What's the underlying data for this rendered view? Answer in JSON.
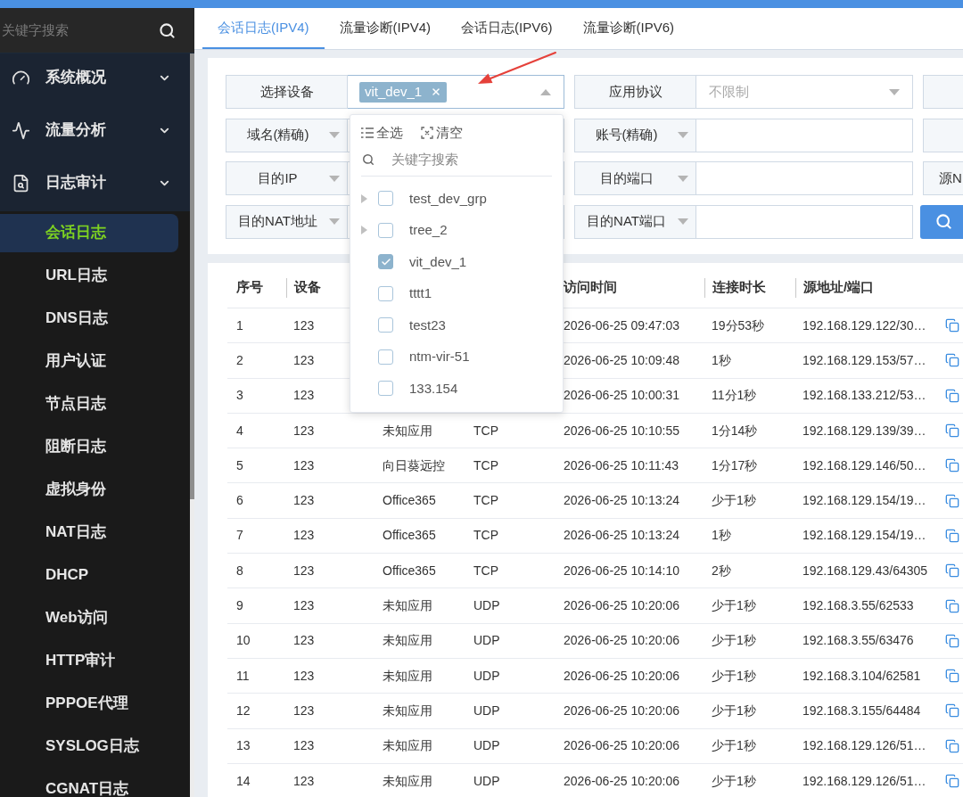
{
  "sidebar": {
    "search": {
      "placeholder": "关键字搜索"
    },
    "menu": [
      {
        "label": "系统概况"
      },
      {
        "label": "流量分析"
      },
      {
        "label": "日志审计",
        "children": [
          {
            "label": "会话日志",
            "selected": true
          },
          {
            "label": "URL日志",
            "selected": false
          },
          {
            "label": "DNS日志",
            "selected": false
          },
          {
            "label": "用户认证",
            "selected": false
          },
          {
            "label": "节点日志",
            "selected": false
          },
          {
            "label": "阻断日志",
            "selected": false
          },
          {
            "label": "虚拟身份",
            "selected": false
          },
          {
            "label": "NAT日志",
            "selected": false
          },
          {
            "label": "DHCP",
            "selected": false
          },
          {
            "label": "Web访问",
            "selected": false
          },
          {
            "label": "HTTP审计",
            "selected": false
          },
          {
            "label": "PPPOE代理",
            "selected": false
          },
          {
            "label": "SYSLOG日志",
            "selected": false
          },
          {
            "label": "CGNAT日志",
            "selected": false
          }
        ]
      }
    ]
  },
  "tabs": [
    {
      "label": "会话日志(IPV4)",
      "selected": true
    },
    {
      "label": "流量诊断(IPV4)",
      "selected": false
    },
    {
      "label": "会话日志(IPV6)",
      "selected": false
    },
    {
      "label": "流量诊断(IPV6)",
      "selected": false
    }
  ],
  "filters": {
    "rows": [
      {
        "fields": [
          {
            "kind": "tag-select",
            "label": "选择设备",
            "label_menu": false,
            "tags": [
              "vit_dev_1"
            ],
            "expanded": true,
            "dropdown": {
              "actions": [
                {
                  "kind": "select-all",
                  "label": "全选"
                },
                {
                  "kind": "clear",
                  "label": "清空"
                }
              ],
              "search": {
                "placeholder": "关键字搜索"
              },
              "items": [
                {
                  "kind": "group",
                  "label": "test_dev_grp",
                  "checked": false
                },
                {
                  "kind": "group",
                  "label": "tree_2",
                  "checked": false
                },
                {
                  "kind": "device",
                  "label": "vit_dev_1",
                  "checked": true
                },
                {
                  "kind": "device",
                  "label": "tttt1",
                  "checked": false
                },
                {
                  "kind": "device",
                  "label": "test23",
                  "checked": false
                },
                {
                  "kind": "device",
                  "label": "ntm-vir-51",
                  "checked": false
                },
                {
                  "kind": "device",
                  "label": "133.154",
                  "checked": false
                }
              ]
            }
          },
          {
            "kind": "select",
            "label": "应用协议",
            "label_menu": false,
            "placeholder": "不限制",
            "expanded": false
          },
          {
            "kind": "cut-label"
          }
        ]
      },
      {
        "fields": [
          {
            "kind": "input",
            "label": "域名(精确)",
            "label_menu": true
          },
          {
            "kind": "input",
            "label": "账号(精确)",
            "label_menu": true
          },
          {
            "kind": "cut-label"
          }
        ]
      },
      {
        "fields": [
          {
            "kind": "input",
            "label": "目的IP",
            "label_menu": true
          },
          {
            "kind": "input",
            "label": "目的端口",
            "label_menu": true
          },
          {
            "kind": "cut-label",
            "label": "源N"
          }
        ]
      },
      {
        "fields": [
          {
            "kind": "input",
            "label": "目的NAT地址",
            "label_menu": true
          },
          {
            "kind": "input",
            "label": "目的NAT端口",
            "label_menu": true
          },
          {
            "kind": "search-button"
          }
        ]
      }
    ]
  },
  "table": {
    "header": {
      "index": "序号",
      "device": "设备",
      "time": "访问时间",
      "duration": "连接时长",
      "source": "源地址/端口"
    },
    "rows": [
      {
        "index": "1",
        "device": "123",
        "time": "2026-06-25 09:47:03",
        "duration": "19分53秒",
        "source": "192.168.129.122/30…"
      },
      {
        "index": "2",
        "device": "123",
        "time": "2026-06-25 10:09:48",
        "duration": "1秒",
        "source": "192.168.129.153/57…"
      },
      {
        "index": "3",
        "device": "123",
        "time": "2026-06-25 10:00:31",
        "duration": "11分1秒",
        "source": "192.168.133.212/53…"
      },
      {
        "index": "4",
        "device": "123",
        "app": "未知应用",
        "protocol": "TCP",
        "time": "2026-06-25 10:10:55",
        "duration": "1分14秒",
        "source": "192.168.129.139/39…"
      },
      {
        "index": "5",
        "device": "123",
        "app": "向日葵远控",
        "protocol": "TCP",
        "time": "2026-06-25 10:11:43",
        "duration": "1分17秒",
        "source": "192.168.129.146/50…"
      },
      {
        "index": "6",
        "device": "123",
        "app": "Office365",
        "protocol": "TCP",
        "time": "2026-06-25 10:13:24",
        "duration": "少于1秒",
        "source": "192.168.129.154/19…"
      },
      {
        "index": "7",
        "device": "123",
        "app": "Office365",
        "protocol": "TCP",
        "time": "2026-06-25 10:13:24",
        "duration": "1秒",
        "source": "192.168.129.154/19…"
      },
      {
        "index": "8",
        "device": "123",
        "app": "Office365",
        "protocol": "TCP",
        "time": "2026-06-25 10:14:10",
        "duration": "2秒",
        "source": "192.168.129.43/64305"
      },
      {
        "index": "9",
        "device": "123",
        "app": "未知应用",
        "protocol": "UDP",
        "time": "2026-06-25 10:20:06",
        "duration": "少于1秒",
        "source": "192.168.3.55/62533"
      },
      {
        "index": "10",
        "device": "123",
        "app": "未知应用",
        "protocol": "UDP",
        "time": "2026-06-25 10:20:06",
        "duration": "少于1秒",
        "source": "192.168.3.55/63476"
      },
      {
        "index": "11",
        "device": "123",
        "app": "未知应用",
        "protocol": "UDP",
        "time": "2026-06-25 10:20:06",
        "duration": "少于1秒",
        "source": "192.168.3.104/62581"
      },
      {
        "index": "12",
        "device": "123",
        "app": "未知应用",
        "protocol": "UDP",
        "time": "2026-06-25 10:20:06",
        "duration": "少于1秒",
        "source": "192.168.3.155/64484"
      },
      {
        "index": "13",
        "device": "123",
        "app": "未知应用",
        "protocol": "UDP",
        "time": "2026-06-25 10:20:06",
        "duration": "少于1秒",
        "source": "192.168.129.126/51…"
      },
      {
        "index": "14",
        "device": "123",
        "app": "未知应用",
        "protocol": "UDP",
        "time": "2026-06-25 10:20:06",
        "duration": "少于1秒",
        "source": "192.168.129.126/51…"
      }
    ]
  }
}
